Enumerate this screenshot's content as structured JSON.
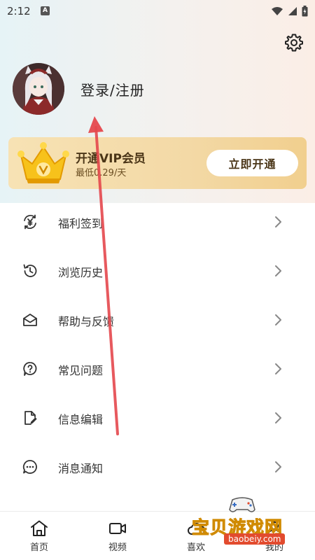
{
  "status_bar": {
    "time": "2:12",
    "notification_letter": "A"
  },
  "profile": {
    "login_label": "登录/注册"
  },
  "vip": {
    "title": "开通VIP会员",
    "subtitle": "最低0.29/天",
    "button_label": "立即开通"
  },
  "menu": {
    "items": [
      {
        "label": "福利签到",
        "icon": "yen-cycle-icon"
      },
      {
        "label": "浏览历史",
        "icon": "history-icon"
      },
      {
        "label": "帮助与反馈",
        "icon": "mail-open-icon"
      },
      {
        "label": "常见问题",
        "icon": "question-bubble-icon"
      },
      {
        "label": "信息编辑",
        "icon": "edit-document-icon"
      },
      {
        "label": "消息通知",
        "icon": "message-dots-icon"
      },
      {
        "label": "",
        "icon": "partial-item-icon"
      }
    ]
  },
  "tabbar": {
    "tabs": [
      {
        "label": "首页",
        "icon": "home-icon"
      },
      {
        "label": "视频",
        "icon": "video-icon"
      },
      {
        "label": "喜欢",
        "icon": "like-icon"
      },
      {
        "label": "我的",
        "icon": "profile-icon"
      }
    ]
  },
  "watermark": {
    "text": "宝贝游戏网",
    "url": "baobeiy.com"
  },
  "colors": {
    "accent_arrow": "#e5484d",
    "vip_text": "#4a3517",
    "vip_card": "#f3d9a6"
  }
}
